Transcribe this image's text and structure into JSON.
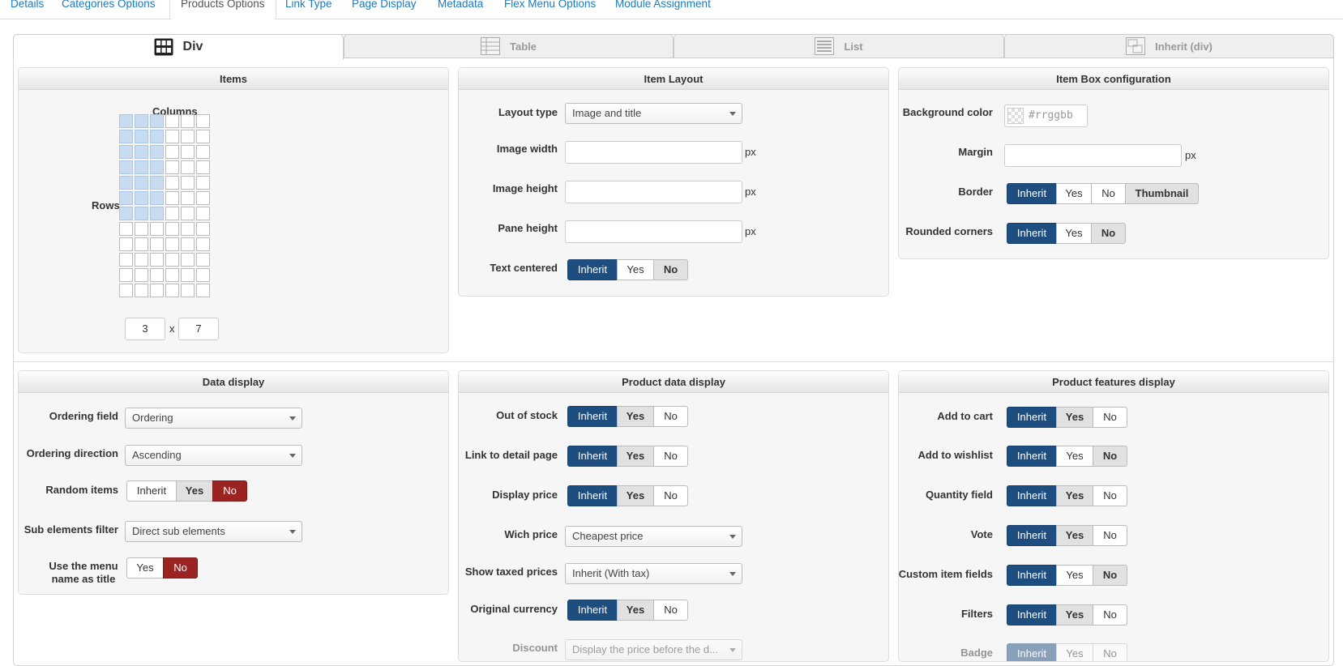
{
  "top_tabs": [
    "Details",
    "Categories Options",
    "Products Options",
    "Link Type",
    "Page Display",
    "Metadata",
    "Flex Menu Options",
    "Module Assignment"
  ],
  "layout_tabs": [
    "Div",
    "Table",
    "List",
    "Inherit (div)"
  ],
  "items": {
    "title": "Items",
    "columns_label": "Columns",
    "rows_label": "Rows",
    "grid_columns_total": 6,
    "grid_rows_total": 12,
    "columns": "3",
    "rows": "7",
    "times": "x"
  },
  "item_layout": {
    "title": "Item Layout",
    "layout_type_label": "Layout type",
    "layout_type_value": "Image and title",
    "image_width_label": "Image width",
    "image_height_label": "Image height",
    "pane_height_label": "Pane height",
    "unit": "px",
    "text_centered_label": "Text centered",
    "text_centered_options": [
      "Inherit",
      "Yes",
      "No"
    ]
  },
  "item_box": {
    "title": "Item Box configuration",
    "bg_color_label": "Background color",
    "bg_color_placeholder": "#rrggbb",
    "margin_label": "Margin",
    "unit": "px",
    "border_label": "Border",
    "border_options": [
      "Inherit",
      "Yes",
      "No",
      "Thumbnail"
    ],
    "rounded_label": "Rounded corners",
    "rounded_options": [
      "Inherit",
      "Yes",
      "No"
    ]
  },
  "data_display": {
    "title": "Data display",
    "ordering_field_label": "Ordering field",
    "ordering_field_value": "Ordering",
    "ordering_direction_label": "Ordering direction",
    "ordering_direction_value": "Ascending",
    "random_items_label": "Random items",
    "random_items_options": [
      "Inherit",
      "Yes",
      "No"
    ],
    "sub_elements_label": "Sub elements filter",
    "sub_elements_value": "Direct sub elements",
    "menu_name_label": "Use the menu name as title",
    "menu_name_options": [
      "Yes",
      "No"
    ]
  },
  "product_data": {
    "title": "Product data display",
    "out_of_stock_label": "Out of stock",
    "link_detail_label": "Link to detail page",
    "display_price_label": "Display price",
    "wich_price_label": "Wich price",
    "wich_price_value": "Cheapest price",
    "taxed_label": "Show taxed prices",
    "taxed_value": "Inherit (With tax)",
    "orig_currency_label": "Original currency",
    "discount_label": "Discount",
    "discount_value": "Display the price before the d...",
    "options": [
      "Inherit",
      "Yes",
      "No"
    ]
  },
  "product_features": {
    "title": "Product features display",
    "add_to_cart_label": "Add to cart",
    "add_to_wishlist_label": "Add to wishlist",
    "quantity_label": "Quantity field",
    "vote_label": "Vote",
    "custom_fields_label": "Custom item fields",
    "filters_label": "Filters",
    "badge_label": "Badge",
    "options": [
      "Inherit",
      "Yes",
      "No"
    ]
  },
  "colors": {
    "accent_blue": "#1e4d80",
    "accent_red": "#9b2322",
    "link": "#1a7bbf",
    "grid_selected": "#c8dcf1"
  }
}
